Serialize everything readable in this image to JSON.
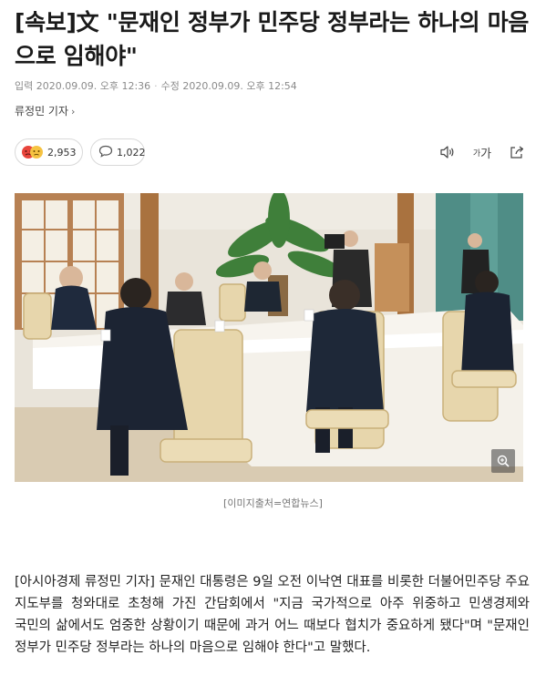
{
  "article": {
    "title": "[속보]文 \"문재인 정부가 민주당 정부라는 하나의 마음으로 임해야\"",
    "input_date": "입력 2020.09.09. 오후 12:36",
    "separator": "·",
    "modified_date": "수정 2020.09.09. 오후 12:54",
    "reporter": "류정민 기자",
    "reporter_chevron": "›",
    "reactions": {
      "count": "2,953"
    },
    "comments": {
      "count": "1,022"
    },
    "tools": {
      "text_size_label": "가"
    },
    "image_caption": "[이미지출처=연합뉴스]",
    "body": "[아시아경제 류정민 기자] 문재인 대통령은 9일 오전 이낙연 대표를 비롯한 더불어민주당 주요 지도부를 청와대로 초청해 가진 간담회에서 \"지금 국가적으로 아주 위중하고 민생경제와 국민의 삶에서도 엄중한 상황이기 때문에 과거 어느 때보다 협치가 중요하게 됐다\"며 \"문재인 정부가 민주당 정부라는 하나의 마음으로 임해야 한다\"고 말했다."
  },
  "icons": {
    "reaction_angry": "angry-face-emoji",
    "reaction_sad": "sad-face-emoji",
    "comment": "speech-bubble-icon",
    "audio": "speaker-icon",
    "font_size": "text-size-icon",
    "share": "share-icon",
    "zoom": "magnify-icon"
  },
  "colors": {
    "title": "#1a1a1a",
    "meta": "#8a8a8a",
    "reaction_angry": "#e8453c",
    "reaction_sad": "#f6c342"
  }
}
